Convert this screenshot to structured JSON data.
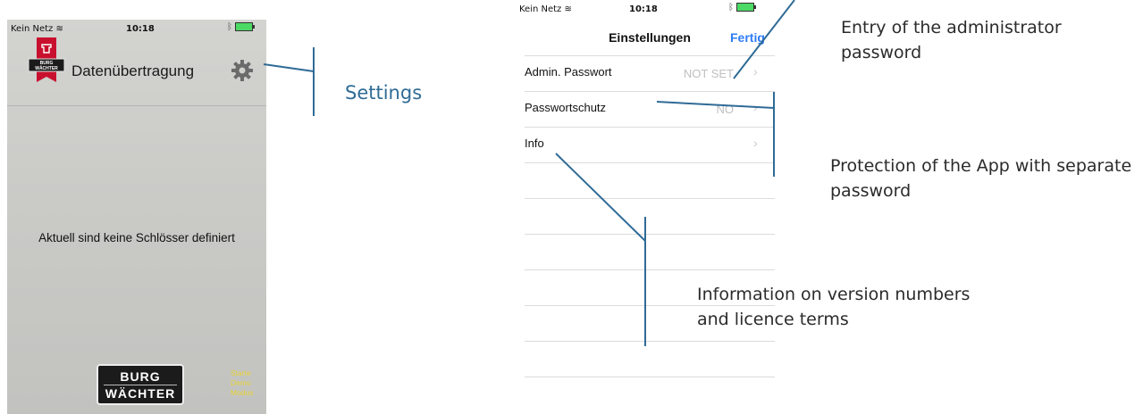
{
  "left_screen": {
    "status_bar": {
      "carrier": "Kein Netz",
      "time": "10:18"
    },
    "brand_logo_text": "BURG WÄCHTER",
    "title": "Datenübertragung",
    "settings_icon": "gear-icon",
    "empty_message": "Aktuell sind keine Schlösser definiert",
    "bottom_logo": {
      "line1": "BURG",
      "line2": "WÄCHTER"
    },
    "demo_link": "Starte Demo Modus"
  },
  "settings_annotation": "Settings",
  "right_screen": {
    "status_bar": {
      "carrier": "Kein Netz",
      "time": "10:18"
    },
    "nav_title": "Einstellungen",
    "done_button": "Fertig",
    "rows": [
      {
        "label": "Admin. Passwort",
        "value": "NOT SET"
      },
      {
        "label": "Passwortschutz",
        "value": "NO"
      },
      {
        "label": "Info",
        "value": ""
      }
    ]
  },
  "annotations": {
    "admin_password": "Entry of the administrator password",
    "protection": "Protection of the App with separate password",
    "info": "Information on version numbers and licence terms"
  },
  "colors": {
    "annotation_line": "#2f6b96",
    "ios_blue": "#2e7cf6",
    "battery_green": "#4cd964",
    "demo_yellow": "#e8d53a",
    "logo_red": "#c8102e"
  }
}
